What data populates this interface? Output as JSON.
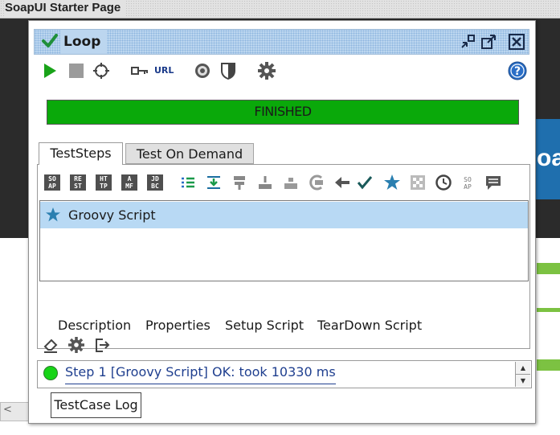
{
  "background": {
    "title": "SoapUI Starter Page",
    "blue_banner_text": "oa",
    "scroll_left_glyph": "<"
  },
  "window": {
    "title": "Loop",
    "title_buttons": [
      "minimize-icon",
      "maximize-icon",
      "close-icon"
    ]
  },
  "toolbar": {
    "items": [
      "run-icon",
      "stop-icon",
      "loop-options-icon",
      "key-icon",
      "url-icon",
      "target-icon",
      "shield-icon",
      "gear-icon",
      "help-icon"
    ],
    "url_label": "URL"
  },
  "progress": {
    "status": "FINISHED",
    "value": 1.0,
    "color": "#0aa90a"
  },
  "tabs": [
    {
      "label": "TestSteps",
      "active": true
    },
    {
      "label": "Test On Demand",
      "active": false
    }
  ],
  "step_toolbar": {
    "box_icons": [
      {
        "name": "soap-icon",
        "text": "SO\nAP"
      },
      {
        "name": "rest-icon",
        "text": "RE\nST"
      },
      {
        "name": "http-icon",
        "text": "HT\nTP"
      },
      {
        "name": "amf-icon",
        "text": "A\nMF"
      },
      {
        "name": "jdbc-icon",
        "text": "JD\nBC"
      }
    ]
  },
  "steps": [
    {
      "label": "Groovy Script",
      "selected": true
    }
  ],
  "sub_tabs": [
    "Description",
    "Properties",
    "Setup Script",
    "TearDown Script"
  ],
  "log": {
    "entry": "Step 1 [Groovy Script] OK: took 10330 ms",
    "status_color": "#17d417"
  },
  "bottom_tab": "TestCase Log",
  "colors": {
    "accent": "#1f6fae",
    "titlebar": "#bcd6ef",
    "selected_row": "#b8d9f4",
    "run_green": "#19a319"
  }
}
